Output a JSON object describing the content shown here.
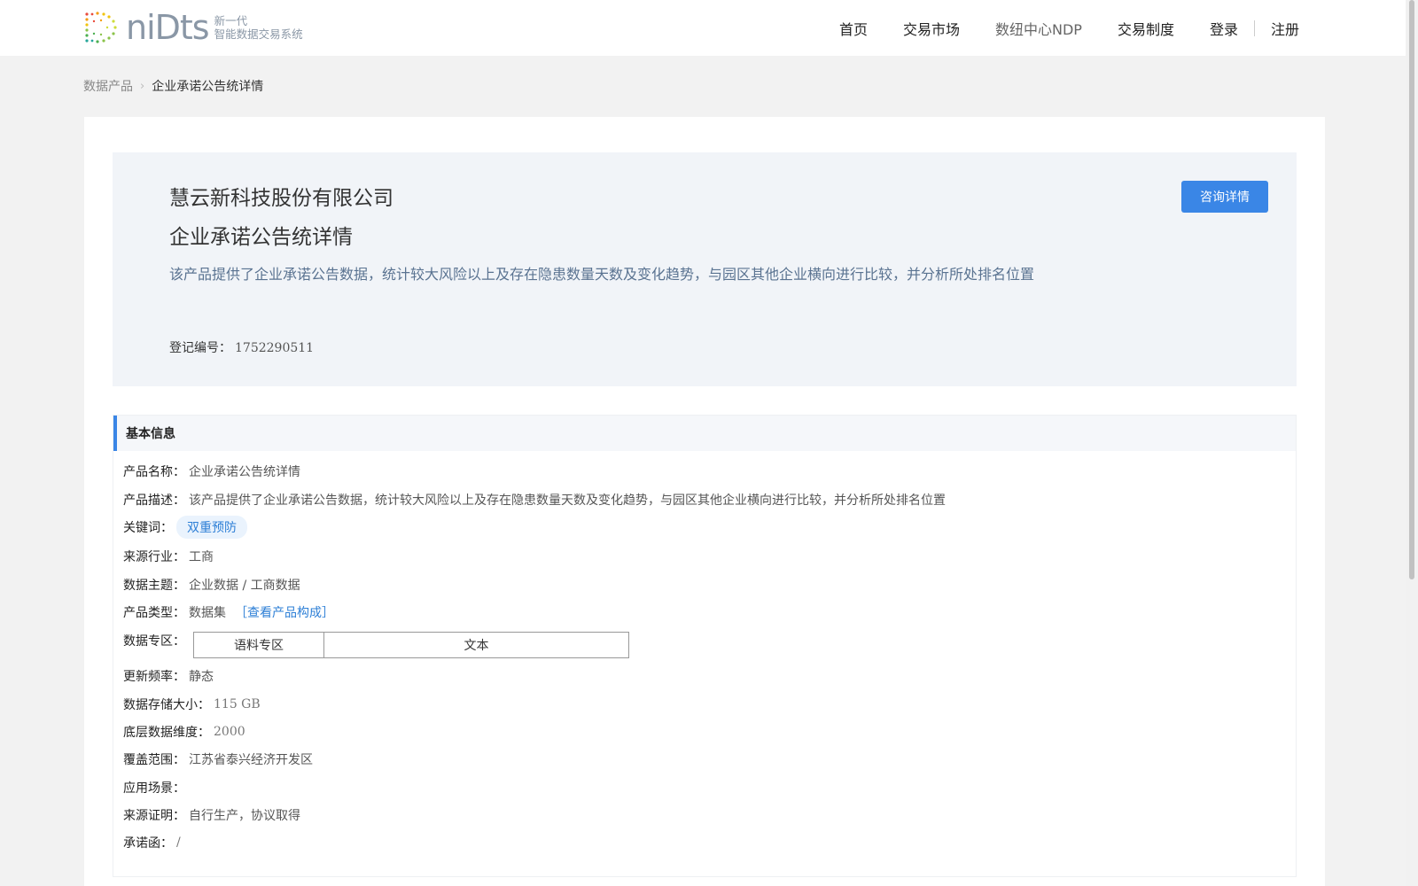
{
  "logo": {
    "wordmark": "niDts",
    "sub_line1": "新一代",
    "sub_line2": "智能数据交易系统"
  },
  "nav": {
    "items": [
      "首页",
      "交易市场",
      "数纽中心NDP",
      "交易制度",
      "登录",
      "注册"
    ]
  },
  "breadcrumb": {
    "parent": "数据产品",
    "separator": "›",
    "current": "企业承诺公告统详情"
  },
  "hero": {
    "company": "慧云新科技股份有限公司",
    "title": "企业承诺公告统详情",
    "description": "该产品提供了企业承诺公告数据，统计较大风险以上及存在隐患数量天数及变化趋势，与园区其他企业横向进行比较，并分析所处排名位置",
    "reg_label": "登记编号：",
    "reg_value": "1752290511",
    "consult_button": "咨询详情"
  },
  "basic_info": {
    "heading": "基本信息",
    "product_name_label": "产品名称：",
    "product_name": "企业承诺公告统详情",
    "product_desc_label": "产品描述：",
    "product_desc": "该产品提供了企业承诺公告数据，统计较大风险以上及存在隐患数量天数及变化趋势，与园区其他企业横向进行比较，并分析所处排名位置",
    "keywords_label": "关键词：",
    "keyword_tag": "双重预防",
    "industry_label": "来源行业：",
    "industry": "工商",
    "theme_label": "数据主题：",
    "theme": "企业数据 / 工商数据",
    "type_label": "产品类型：",
    "type": "数据集",
    "type_link": "［查看产品构成］",
    "zone_label": "数据专区：",
    "zone_cells": [
      "语料专区",
      "文本"
    ],
    "frequency_label": "更新频率：",
    "frequency": "静态",
    "storage_label": "数据存储大小：",
    "storage": "115 GB",
    "dimension_label": "底层数据维度：",
    "dimension": "2000",
    "coverage_label": "覆盖范围：",
    "coverage": "江苏省泰兴经济开发区",
    "scenario_label": "应用场景：",
    "scenario": "",
    "proof_label": "来源证明：",
    "proof": "自行生产，协议取得",
    "commitment_label": "承诺函：",
    "commitment": "/"
  },
  "colors": {
    "accent": "#3a86e6",
    "link": "#2d7fd6",
    "hero_bg": "#f1f4f8",
    "page_bg": "#f2f2f2"
  }
}
